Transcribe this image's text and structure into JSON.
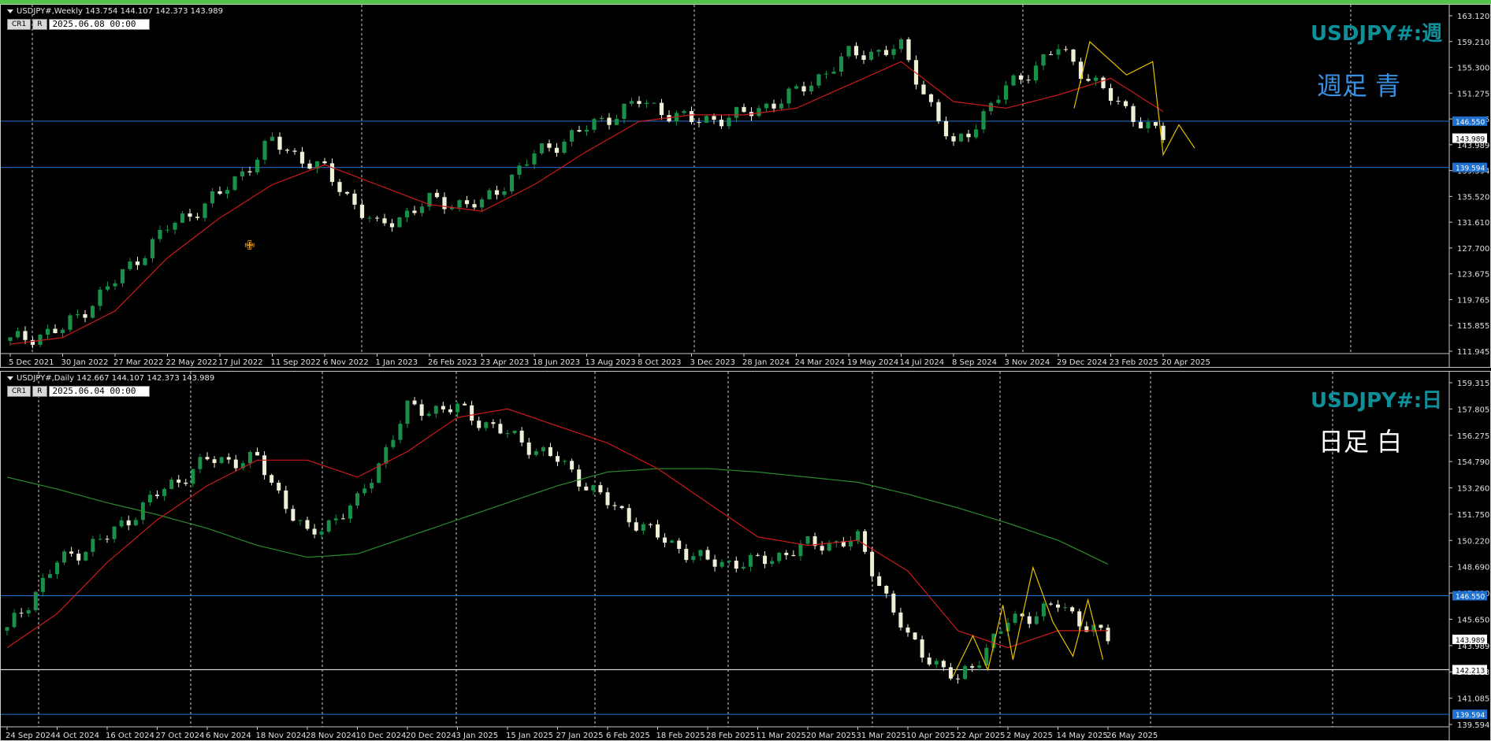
{
  "colors": {
    "background": "#000000",
    "bull": "#1a8f4a",
    "bear": "#f0f0d8",
    "ma_red": "#cc1a1a",
    "ma_green": "#2a8a2a",
    "zigzag": "#e8c000",
    "hline_blue": "#1f6fcf",
    "hline_white": "#ffffff",
    "grid_vline": "#cfcfcf",
    "topbar": "#55c34a"
  },
  "panes": [
    {
      "id": "weekly",
      "header": "USDJPY#,Weekly  143.754 144.107 142.373 143.989",
      "cr_button": "CR1",
      "r_button": "R",
      "date_field": "2025.06.08 00:00",
      "big_title": "USDJPY#:週",
      "subtitle": "週足  青",
      "subtitle_color": "#3a8fe0",
      "price_labels": [
        "163.120",
        "159.210",
        "155.300",
        "151.275",
        "147.185",
        "143.989",
        "139.594",
        "135.520",
        "131.610",
        "127.700",
        "123.675",
        "119.765",
        "115.855",
        "111.945"
      ],
      "x_labels": [
        "5 Dec 2021",
        "30 Jan 2022",
        "27 Mar 2022",
        "22 May 2022",
        "17 Jul 2022",
        "11 Sep 2022",
        "6 Nov 2022",
        "1 Jan 2023",
        "26 Feb 2023",
        "23 Apr 2023",
        "18 Jun 2023",
        "13 Aug 2023",
        "8 Oct 2023",
        "3 Dec 2023",
        "28 Jan 2024",
        "24 Mar 2024",
        "19 May 2024",
        "14 Jul 2024",
        "8 Sep 2024",
        "3 Nov 2024",
        "29 Dec 2024",
        "23 Feb 2025",
        "20 Apr 2025"
      ],
      "hline_tags": [
        {
          "text": "146.550",
          "bg": "#1f6fcf",
          "fg": "#ffffff"
        },
        {
          "text": "143.989",
          "bg": "#ffffff",
          "fg": "#000000"
        },
        {
          "text": "139.594",
          "bg": "#1f6fcf",
          "fg": "#ffffff"
        }
      ]
    },
    {
      "id": "daily",
      "header": "USDJPY#,Daily  142.667 144.107 142.373 143.989",
      "cr_button": "CR1",
      "r_button": "R",
      "date_field": "2025.06.04 00:00",
      "big_title": "USDJPY#:日",
      "subtitle": "日足    白",
      "subtitle_color": "#ffffff",
      "price_labels": [
        "159.315",
        "157.805",
        "156.275",
        "154.790",
        "153.260",
        "151.750",
        "150.220",
        "148.690",
        "147.180",
        "145.650",
        "143.989",
        "142.213",
        "141.085",
        "139.594"
      ],
      "x_labels": [
        "24 Sep 2024",
        "4 Oct 2024",
        "16 Oct 2024",
        "27 Oct 2024",
        "6 Nov 2024",
        "18 Nov 2024",
        "28 Nov 2024",
        "10 Dec 2024",
        "20 Dec 2024",
        "3 Jan 2025",
        "15 Jan 2025",
        "27 Jan 2025",
        "6 Feb 2025",
        "18 Feb 2025",
        "28 Feb 2025",
        "11 Mar 2025",
        "20 Mar 2025",
        "31 Mar 2025",
        "10 Apr 2025",
        "22 Apr 2025",
        "2 May 2025",
        "14 May 2025",
        "26 May 2025"
      ],
      "hline_tags": [
        {
          "text": "146.550",
          "bg": "#1f6fcf",
          "fg": "#ffffff"
        },
        {
          "text": "143.989",
          "bg": "#ffffff",
          "fg": "#000000"
        },
        {
          "text": "142.213",
          "bg": "#ffffff",
          "fg": "#000000"
        },
        {
          "text": "139.594",
          "bg": "#1f6fcf",
          "fg": "#ffffff"
        }
      ]
    }
  ],
  "chart_data": [
    {
      "type": "candlestick",
      "symbol": "USDJPY#",
      "timeframe": "Weekly",
      "x": [
        "5 Dec 2021",
        "30 Jan 2022",
        "27 Mar 2022",
        "22 May 2022",
        "17 Jul 2022",
        "11 Sep 2022",
        "6 Nov 2022",
        "1 Jan 2023",
        "26 Feb 2023",
        "23 Apr 2023",
        "18 Jun 2023",
        "13 Aug 2023",
        "8 Oct 2023",
        "3 Dec 2023",
        "28 Jan 2024",
        "24 Mar 2024",
        "19 May 2024",
        "14 Jul 2024",
        "8 Sep 2024",
        "3 Nov 2024",
        "29 Dec 2024",
        "23 Feb 2025",
        "20 Apr 2025"
      ],
      "close_approx": [
        113.5,
        115.2,
        122.5,
        130.5,
        135.5,
        143.5,
        139.0,
        130.5,
        134.5,
        134.0,
        141.5,
        145.5,
        149.5,
        146.5,
        147.5,
        150.8,
        156.5,
        157.5,
        142.5,
        151.5,
        157.5,
        150.0,
        143.989
      ],
      "ma_red_approx": [
        113.0,
        114.0,
        118.0,
        126.0,
        132.0,
        137.0,
        140.0,
        137.0,
        134.0,
        133.0,
        137.0,
        142.0,
        146.5,
        147.5,
        147.5,
        148.5,
        152.0,
        155.5,
        149.5,
        148.5,
        150.5,
        153.0,
        148.0
      ],
      "ylim": [
        111.945,
        163.12
      ],
      "horizontal_lines": [
        146.55,
        139.594
      ],
      "grid": false
    },
    {
      "type": "candlestick",
      "symbol": "USDJPY#",
      "timeframe": "Daily",
      "x": [
        "24 Sep 2024",
        "4 Oct 2024",
        "16 Oct 2024",
        "27 Oct 2024",
        "6 Nov 2024",
        "18 Nov 2024",
        "28 Nov 2024",
        "10 Dec 2024",
        "20 Dec 2024",
        "3 Jan 2025",
        "15 Jan 2025",
        "27 Jan 2025",
        "6 Feb 2025",
        "18 Feb 2025",
        "28 Feb 2025",
        "11 Mar 2025",
        "20 Mar 2025",
        "31 Mar 2025",
        "10 Apr 2025",
        "22 Apr 2025",
        "2 May 2025",
        "14 May 2025",
        "26 May 2025"
      ],
      "close_approx": [
        144.5,
        148.5,
        150.0,
        152.5,
        154.5,
        154.5,
        150.0,
        152.0,
        157.5,
        157.5,
        156.0,
        154.5,
        152.0,
        150.0,
        148.5,
        148.5,
        149.5,
        149.8,
        144.0,
        141.5,
        145.0,
        146.0,
        143.989
      ],
      "ma_red_approx": [
        143.5,
        145.5,
        148.5,
        151.0,
        153.0,
        154.5,
        154.5,
        153.5,
        155.0,
        157.0,
        157.5,
        156.5,
        155.5,
        154.0,
        152.0,
        150.0,
        149.5,
        149.8,
        148.0,
        144.5,
        143.5,
        144.5,
        144.5
      ],
      "ma_green_approx": [
        153.5,
        152.8,
        152.0,
        151.3,
        150.5,
        149.5,
        148.8,
        149.0,
        150.0,
        151.0,
        152.0,
        153.0,
        153.8,
        154.0,
        154.0,
        153.8,
        153.5,
        153.2,
        152.5,
        151.7,
        150.8,
        149.8,
        148.4
      ],
      "ylim": [
        139.0,
        159.315
      ],
      "horizontal_lines": [
        146.55,
        142.213,
        139.594
      ],
      "grid": false
    }
  ]
}
